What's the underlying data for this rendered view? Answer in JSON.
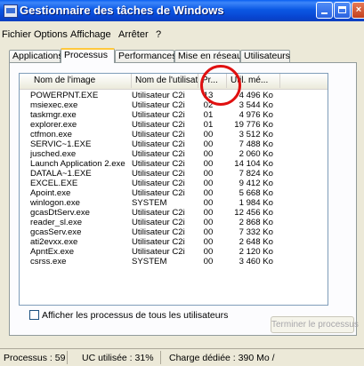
{
  "window": {
    "title": "Gestionnaire des tâches de Windows"
  },
  "menu": [
    {
      "label": "Fichier"
    },
    {
      "label": "Options"
    },
    {
      "label": "Affichage"
    },
    {
      "label": "Arrêter"
    },
    {
      "label": "?"
    }
  ],
  "tabs": [
    {
      "label": "Applications"
    },
    {
      "label": "Processus"
    },
    {
      "label": "Performances"
    },
    {
      "label": "Mise en réseau"
    },
    {
      "label": "Utilisateurs"
    }
  ],
  "table": {
    "headers": [
      "Nom de l'image",
      "Nom de l'utilisateur",
      "Pr...",
      "Util. mé..."
    ],
    "rows": [
      [
        "POWERPNT.EXE",
        "Utilisateur C2i",
        "13",
        "4 496 Ko"
      ],
      [
        "msiexec.exe",
        "Utilisateur C2i",
        "02",
        "3 544 Ko"
      ],
      [
        "taskmgr.exe",
        "Utilisateur C2i",
        "01",
        "4 976 Ko"
      ],
      [
        "explorer.exe",
        "Utilisateur C2i",
        "01",
        "19 776 Ko"
      ],
      [
        "ctfmon.exe",
        "Utilisateur C2i",
        "00",
        "3 512 Ko"
      ],
      [
        "SERVIC~1.EXE",
        "Utilisateur C2i",
        "00",
        "7 488 Ko"
      ],
      [
        "jusched.exe",
        "Utilisateur C2i",
        "00",
        "2 060 Ko"
      ],
      [
        "Launch Application 2.exe",
        "Utilisateur C2i",
        "00",
        "14 104 Ko"
      ],
      [
        "DATALA~1.EXE",
        "Utilisateur C2i",
        "00",
        "7 824 Ko"
      ],
      [
        "EXCEL.EXE",
        "Utilisateur C2i",
        "00",
        "9 412 Ko"
      ],
      [
        "Apoint.exe",
        "Utilisateur C2i",
        "00",
        "5 668 Ko"
      ],
      [
        "winlogon.exe",
        "SYSTEM",
        "00",
        "1 984 Ko"
      ],
      [
        "gcasDtServ.exe",
        "Utilisateur C2i",
        "00",
        "12 456 Ko"
      ],
      [
        "reader_sl.exe",
        "Utilisateur C2i",
        "00",
        "2 868 Ko"
      ],
      [
        "gcasServ.exe",
        "Utilisateur C2i",
        "00",
        "7 332 Ko"
      ],
      [
        "ati2evxx.exe",
        "Utilisateur C2i",
        "00",
        "2 648 Ko"
      ],
      [
        "ApntEx.exe",
        "Utilisateur C2i",
        "00",
        "2 120 Ko"
      ],
      [
        "csrss.exe",
        "SYSTEM",
        "00",
        "3 460 Ko"
      ]
    ]
  },
  "checkbox": {
    "label": "Afficher les processus de tous les utilisateurs"
  },
  "end_button": {
    "label": "Terminer le processus"
  },
  "status": {
    "processes": "Processus : 59",
    "cpu": "UC utilisée : 31%",
    "commit": "Charge dédiée : 390 Mo /"
  },
  "colors": {
    "annotation": "#e01010",
    "title_bar": "#0a5ff2"
  }
}
